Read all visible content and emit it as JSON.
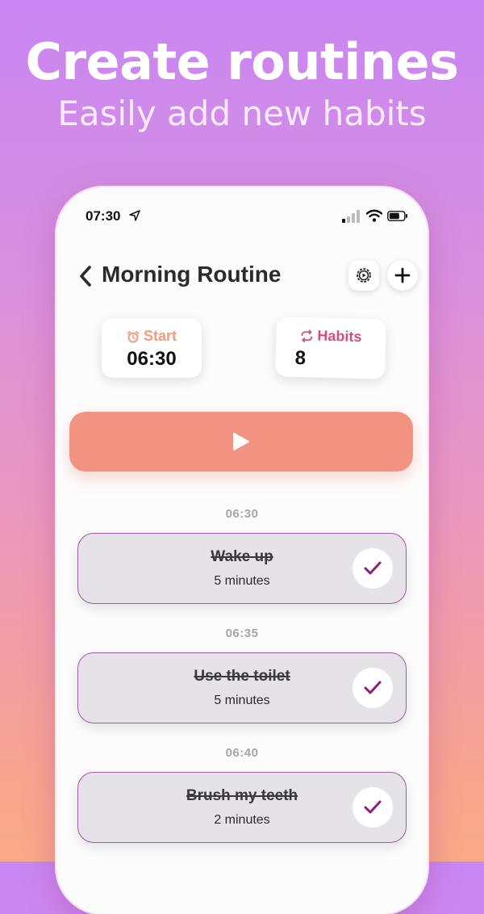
{
  "promo": {
    "headline": "Create routines",
    "subline": "Easily add new habits"
  },
  "status_bar": {
    "time": "07:30"
  },
  "header": {
    "title": "Morning Routine"
  },
  "stats": {
    "start": {
      "label": "Start",
      "value": "06:30",
      "icon": "alarm-clock-icon"
    },
    "habits": {
      "label": "Habits",
      "value": "8",
      "icon": "repeat-icon"
    }
  },
  "colors": {
    "accent": "#f29382",
    "habits_accent": "#d54d7b",
    "check": "#8b1f7e"
  },
  "habits": [
    {
      "time": "06:30",
      "name": "Wake up",
      "duration": "5 minutes",
      "done": true
    },
    {
      "time": "06:35",
      "name": "Use the toilet",
      "duration": "5 minutes",
      "done": true
    },
    {
      "time": "06:40",
      "name": "Brush my teeth",
      "duration": "2 minutes",
      "done": true
    }
  ]
}
